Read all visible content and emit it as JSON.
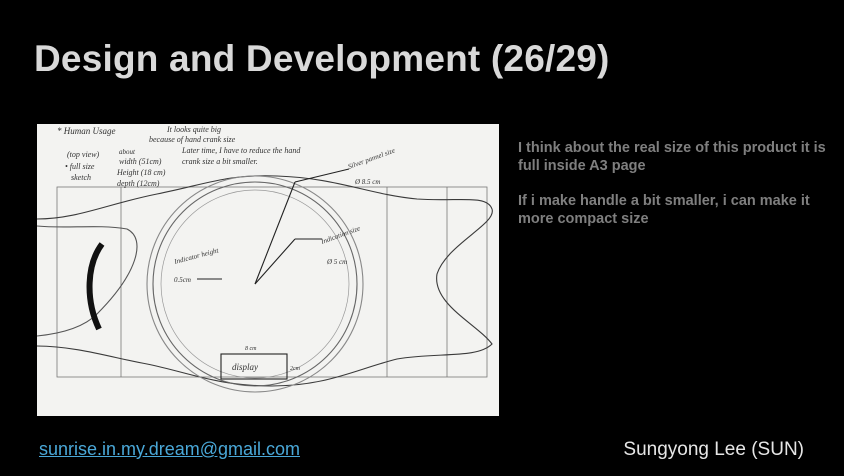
{
  "slide": {
    "title": "Design and Development (26/29)",
    "notes": [
      "I think about the real size of this product it is full inside A3 page",
      "If i make handle a bit smaller, i can make it more compact size"
    ],
    "email": "sunrise.in.my.dream@gmail.com",
    "author": "Sungyong Lee (SUN)"
  },
  "sketch": {
    "header_label": "* Human Usage",
    "comment_line1": "It looks quite big",
    "comment_line2": "because of hand crank size",
    "comment_line3": "Later time, I have to reduce the hand",
    "comment_line4": "crank size a bit smaller.",
    "view_label": "(top view)",
    "full_size_label": "• full size",
    "sketch_label": "sketch",
    "about_label": "about",
    "width_label": "width (51cm)",
    "height_label": "Height (18 cm)",
    "depth_label": "depth (12cm)",
    "silver_label": "Silver pannel size",
    "silver_size": "Ø 8.5 cm",
    "indication_label": "Indication size",
    "indication_size": "Ø 5 cm",
    "indicator_label": "Indicator height",
    "indicator_size": "0.5cm",
    "display_label": "display",
    "display_width": "8 cm",
    "display_height": "2cm"
  }
}
